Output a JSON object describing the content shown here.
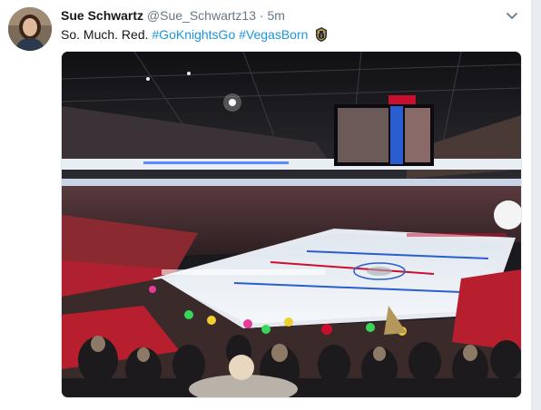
{
  "tweet": {
    "author_name": "Sue Schwartz",
    "author_handle": "@Sue_Schwartz13",
    "separator": "·",
    "time": "5m",
    "text_plain": "So. Much. Red.",
    "hashtags": [
      "#GoKnightsGo",
      "#VegasBorn"
    ],
    "emoji_icon": "vegas-golden-knights-helmet-icon",
    "media_icon": "hockey-arena-photo"
  },
  "colors": {
    "hashtag": "#1b95e0",
    "muted": "#657786",
    "text": "#14171a",
    "fan_red": "#c8102e"
  }
}
